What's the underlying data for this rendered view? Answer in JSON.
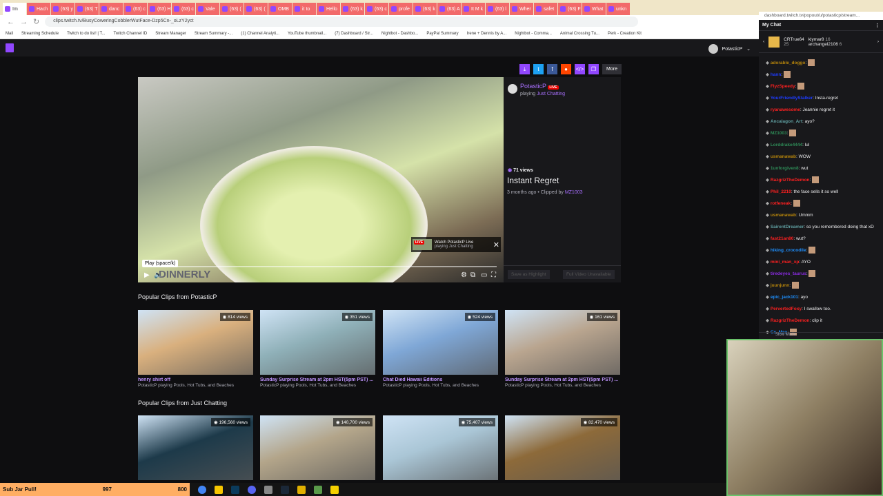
{
  "browser": {
    "tabs": [
      "Im",
      "Hach",
      "(63) y",
      "(63) T",
      "danc",
      "(63) c",
      "(63) H",
      "(63) c",
      "Vale",
      "(63) (",
      "(63) (",
      "OMB",
      "it to",
      "Hello",
      "(63) k",
      "(63) c",
      "profe",
      "(63) k",
      "(63) A",
      "It M k",
      "(63) l",
      "Wher",
      "safet",
      "(63) F",
      "What",
      "unkn"
    ],
    "url": "clips.twitch.tv/BusyCoweringCobblerWutFace-Dzp5Cn-_oLzY2yct",
    "bookmarks": [
      "Mail",
      "Streaming Schedule",
      "Twitch to do list! | T...",
      "Twitch Channel ID",
      "Stream Manager",
      "Stream Summary -...",
      "(1) Channel Analyti...",
      "YouTube thumbnail...",
      "(7) Dashboard / Str...",
      "Nightbot - Dashbo...",
      "PayPal Summary",
      "Irene + Dennis by A...",
      "Nightbot - Comma...",
      "Animal Crossing Tu...",
      "Perk - Creation Kit"
    ]
  },
  "header": {
    "username": "PotasticP"
  },
  "share": {
    "more": "More"
  },
  "player": {
    "tooltip": "Play (space/k)",
    "live_title": "Watch PotasticP Live",
    "live_sub": "playing Just Chatting",
    "live_badge": "LIVE",
    "overlay_text": "DINNERLY"
  },
  "clip": {
    "channel": "PotasticP",
    "live": "LIVE",
    "playing": "playing",
    "game": "Just Chatting",
    "views": "71 views",
    "title": "Instant Regret",
    "age": "3 months ago",
    "clipped_by": "• Clipped by",
    "clipper": "MZ1003",
    "highlight": "Save as Highlight",
    "full_video": "Full Video Unavailable"
  },
  "sections": [
    {
      "title": "Popular Clips from PotasticP",
      "cards": [
        {
          "views": "814 views",
          "title": "henry shirt off",
          "sub": "PotasticP playing Pools, Hot Tubs, and Beaches",
          "c": "#d9b07e"
        },
        {
          "views": "351 views",
          "title": "Sunday Surprise Stream at 2pm HST(5pm PST) ...",
          "sub": "PotasticP playing Pools, Hot Tubs, and Beaches",
          "c": "#8fb0b8"
        },
        {
          "views": "524 views",
          "title": "Chat Died Hawaii Editions",
          "sub": "PotasticP playing Pools, Hot Tubs, and Beaches",
          "c": "#7fa7d6"
        },
        {
          "views": "161 views",
          "title": "Sunday Surprise Stream at 2pm HST(5pm PST) ...",
          "sub": "PotasticP playing Pools, Hot Tubs, and Beaches",
          "c": "#b9a58f"
        }
      ]
    },
    {
      "title": "Popular Clips from Just Chatting",
      "cards": [
        {
          "views": "196,560 views",
          "c": "#1d3a4a"
        },
        {
          "views": "140,700 views",
          "c": "#b3a58a"
        },
        {
          "views": "75,407 views",
          "c": "#aac6d6"
        },
        {
          "views": "82,470 views",
          "c": "#8d6a3a"
        }
      ]
    }
  ],
  "chat": {
    "url": "dashboard.twitch.tv/popout/u/potasticp/stream...",
    "title": "My Chat",
    "gifters": [
      {
        "name": "CRTrue64",
        "count": "25"
      },
      {
        "name": "klymar8",
        "count": "16"
      },
      {
        "name": "archangel2106",
        "count": "6"
      }
    ],
    "messages": [
      {
        "u": "adorable_doggo",
        "t": "",
        "c": "#b8860b"
      },
      {
        "u": "hann",
        "t": "",
        "c": "#1e3cff"
      },
      {
        "u": "FlyzSpeedy",
        "t": "",
        "c": "#ff2020"
      },
      {
        "u": "YourFriendlyStalker",
        "t": "Insta-regret",
        "c": "#1e3cff"
      },
      {
        "u": "ryanawesome",
        "t": "Jeannie regret it",
        "c": "#ff2020"
      },
      {
        "u": "Ancalagon_Art",
        "t": "ayo?",
        "c": "#5f9ea0"
      },
      {
        "u": "MZ1003",
        "t": "",
        "c": "#2e8b57"
      },
      {
        "u": "Lorddrake4444",
        "t": "lul",
        "c": "#2e8b57"
      },
      {
        "u": "usmanawab",
        "t": "WOW",
        "c": "#b8860b"
      },
      {
        "u": "1unforgiven8",
        "t": "wut",
        "c": "#2e8b57"
      },
      {
        "u": "RazgrizTheDemon",
        "t": "",
        "c": "#ff2020"
      },
      {
        "u": "Phil_2210",
        "t": "the face sells it so well",
        "c": "#ff2020"
      },
      {
        "u": "rotfeneak",
        "t": "",
        "c": "#ff2020"
      },
      {
        "u": "usmanawab",
        "t": "Ummm",
        "c": "#b8860b"
      },
      {
        "u": "SairentDreamer",
        "t": "so you remembered doing that xD",
        "c": "#5f9ea0"
      },
      {
        "u": "fast21an80",
        "t": "wut?",
        "c": "#ff2020"
      },
      {
        "u": "hiking_crocodile",
        "t": "",
        "c": "#1e90ff"
      },
      {
        "u": "mini_man_xp",
        "t": "AYO",
        "c": "#ff2020"
      },
      {
        "u": "tiredeyes_taurus",
        "t": "",
        "c": "#8a2be2"
      },
      {
        "u": "juunjunn",
        "t": "",
        "c": "#b8860b"
      },
      {
        "u": "epic_jack101",
        "t": "ayo",
        "c": "#1e90ff"
      },
      {
        "u": "PervertedFoxy",
        "t": "I swallow too.",
        "c": "#ff2020"
      },
      {
        "u": "RazgrizTheDemon",
        "t": "clip it",
        "c": "#ff2020"
      },
      {
        "u": "Cx_Mex",
        "t": "",
        "c": "#1e90ff"
      }
    ],
    "slow_mode": "Slow Mode"
  },
  "taskbar": {
    "jar_label": "Sub Jar Pull!",
    "jar_value": "997",
    "jar_goal": "800"
  }
}
